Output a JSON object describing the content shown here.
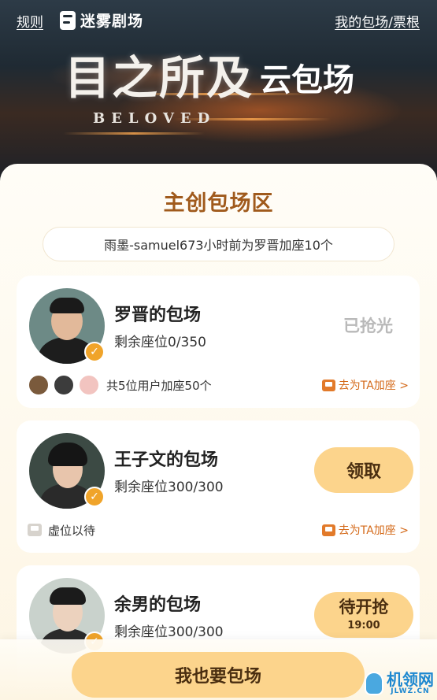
{
  "header": {
    "rules_link": "规则",
    "brand": "迷雾剧场",
    "my_link": "我的包场/票根",
    "movie_title": "目之所及",
    "movie_suffix": "云包场",
    "movie_english": "BELOVED"
  },
  "section": {
    "title": "主创包场区",
    "notice": "雨墨-samuel673小时前为罗晋加座10个"
  },
  "cards": [
    {
      "title": "罗晋的包场",
      "seats": "剩余座位0/350",
      "action": "已抢光",
      "footer_text": "共5位用户加座50个",
      "add_link": "去为TA加座 >"
    },
    {
      "title": "王子文的包场",
      "seats": "剩余座位300/300",
      "action": "领取",
      "footer_text": "虚位以待",
      "add_link": "去为TA加座 >"
    },
    {
      "title": "余男的包场",
      "seats": "剩余座位300/300",
      "action": "待开抢",
      "action_time": "19:00"
    }
  ],
  "bottom": {
    "button": "我也要包场"
  },
  "watermark": {
    "cn": "机领网",
    "en": "JLWZ.CN"
  },
  "colors": {
    "accent": "#fcd48c",
    "title_brown": "#a05a1c",
    "link_orange": "#d46a1a",
    "verify_badge": "#f0a42a",
    "page_bg": "#fdf6e6"
  },
  "icons": [
    "logo-icon",
    "verified-badge-icon",
    "seat-icon",
    "add-seat-icon",
    "chevron-right-icon",
    "mascot-icon"
  ]
}
